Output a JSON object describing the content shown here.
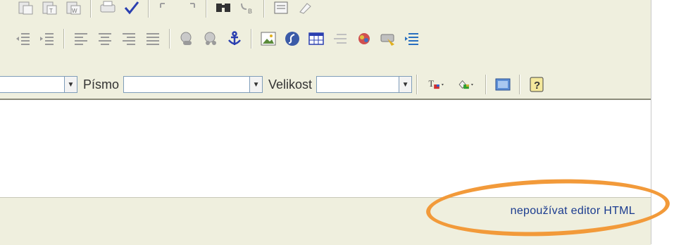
{
  "toolbar": {
    "row1_icons": [
      "paste-icon",
      "paste-text-icon",
      "paste-word-icon",
      "print-icon",
      "spellcheck-icon",
      "undo-icon",
      "redo-icon",
      "find-icon",
      "replace-icon",
      "select-all-icon",
      "remove-format-icon"
    ],
    "row2_icons": [
      "outdent-icon",
      "indent-icon",
      "align-left-icon",
      "align-center-icon",
      "align-right-icon",
      "align-justify-icon",
      "link-icon",
      "unlink-icon",
      "anchor-icon",
      "image-icon",
      "flash-icon",
      "table-icon",
      "horizontal-rule-icon",
      "smiley-icon",
      "special-char-icon",
      "page-break-icon"
    ],
    "font_label": "Písmo",
    "size_label": "Velikost",
    "row3_icons": [
      "text-color-icon",
      "background-color-icon",
      "show-blocks-icon",
      "help-icon"
    ]
  },
  "footer": {
    "toggle_link": "nepoužívat editor HTML"
  },
  "colors": {
    "toolbar_bg": "#efefde",
    "link": "#1a3b8f",
    "highlight": "#f29a3a"
  }
}
